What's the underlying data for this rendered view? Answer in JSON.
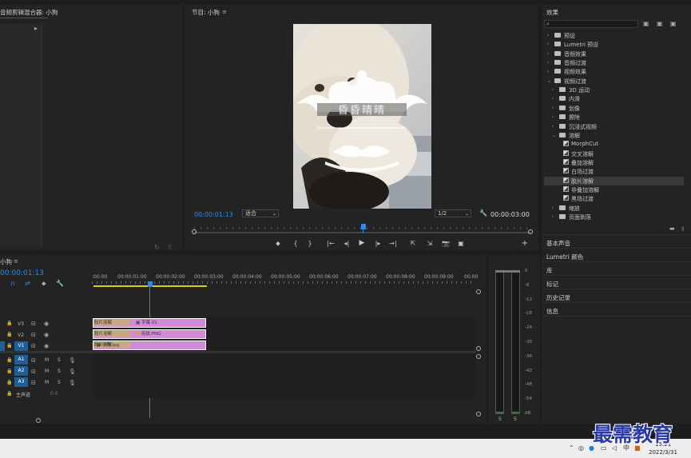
{
  "source_panel": {
    "title": "音频剪辑混合器: 小狗"
  },
  "program": {
    "title": "节目: 小狗",
    "timecode": "00:00:01:13",
    "fit": "适合",
    "resolution": "1/2",
    "duration": "00:00:03:00",
    "overlay_text": "昏昏晴晴"
  },
  "timeline": {
    "title": "小狗",
    "timecode": "00:00:01:13",
    "ruler": [
      ":00:00",
      "00:00:01:00",
      "00:00:02:00",
      "00:00:03:00",
      "00:00:04:00",
      "00:00:05:00",
      "00:00:06:00",
      "00:00:07:00",
      "00:00:08:00",
      "00:00:09:00",
      "00:00"
    ],
    "video_tracks": [
      "V3",
      "V2",
      "V1"
    ],
    "audio_tracks": [
      "A1",
      "A2",
      "A3"
    ],
    "master": {
      "label": "主声道",
      "value": "0.0"
    },
    "mute": "M",
    "solo": "S",
    "clips": [
      {
        "fx": "胶片溶解",
        "name": "字幕 01"
      },
      {
        "fx": "胶片溶解",
        "name": "花纹.PNG"
      },
      {
        "fx": "胶片溶解",
        "name": "小狗.jpg"
      }
    ]
  },
  "meter": {
    "scale": [
      "0",
      "-6",
      "-12",
      "-18",
      "-24",
      "-30",
      "-36",
      "-42",
      "-48",
      "-54",
      "dB"
    ],
    "solo": [
      "S",
      "S"
    ]
  },
  "effects": {
    "title": "效果",
    "items": [
      {
        "label": "预设",
        "level": 0,
        "open": false
      },
      {
        "label": "Lumetri 预设",
        "level": 0,
        "open": false
      },
      {
        "label": "音频效果",
        "level": 0,
        "open": false
      },
      {
        "label": "音频过渡",
        "level": 0,
        "open": false
      },
      {
        "label": "视频效果",
        "level": 0,
        "open": false
      },
      {
        "label": "视频过渡",
        "level": 0,
        "open": true
      },
      {
        "label": "3D 运动",
        "level": 1,
        "open": false
      },
      {
        "label": "内滑",
        "level": 1,
        "open": false
      },
      {
        "label": "划像",
        "level": 1,
        "open": false
      },
      {
        "label": "擦除",
        "level": 1,
        "open": false
      },
      {
        "label": "沉浸式视频",
        "level": 1,
        "open": false
      },
      {
        "label": "溶解",
        "level": 1,
        "open": true
      },
      {
        "label": "MorphCut",
        "level": 2
      },
      {
        "label": "交叉溶解",
        "level": 2
      },
      {
        "label": "叠加溶解",
        "level": 2
      },
      {
        "label": "白场过渡",
        "level": 2
      },
      {
        "label": "胶片溶解",
        "level": 2,
        "selected": true
      },
      {
        "label": "非叠加溶解",
        "level": 2
      },
      {
        "label": "黑场过渡",
        "level": 2
      },
      {
        "label": "缩放",
        "level": 1,
        "open": false
      },
      {
        "label": "页面剥落",
        "level": 1,
        "open": false
      }
    ],
    "sections": [
      "基本声音",
      "Lumetri 颜色",
      "库",
      "标记",
      "历史记录",
      "信息"
    ]
  },
  "taskbar": {
    "time": "15:21",
    "date": "2022/3/31"
  },
  "watermark": "最需教育",
  "colors": {
    "accent": "#2d8ceb",
    "clip": "#d18ad5",
    "fx": "#c8a882"
  }
}
